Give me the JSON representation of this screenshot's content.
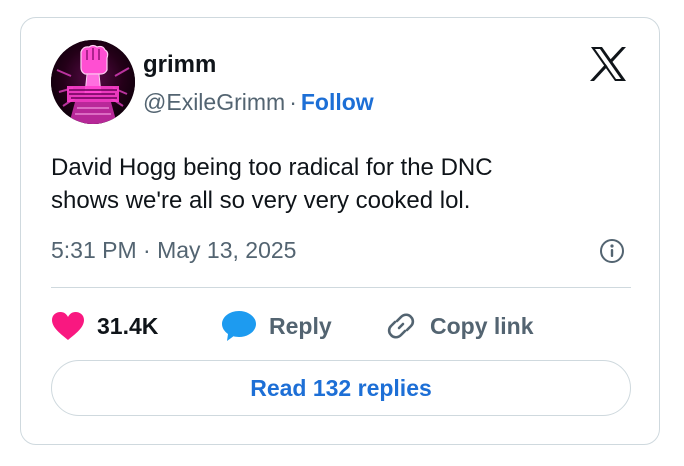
{
  "author": {
    "display_name": "grimm",
    "handle": "@ExileGrimm",
    "separator": "·",
    "follow_label": "Follow",
    "avatar_icon": "pink-raised-fist-avatar"
  },
  "brand": {
    "icon": "x-logo-icon"
  },
  "tweet": {
    "text_line1": "David Hogg being too radical for the DNC",
    "text_line2": "shows we're all so very very cooked lol.",
    "timestamp": "5:31 PM · May 13, 2025"
  },
  "actions": {
    "likes_count": "31.4K",
    "reply_label": "Reply",
    "copy_link_label": "Copy link"
  },
  "read_replies_label": "Read 132 replies",
  "colors": {
    "text_primary": "#0f1419",
    "text_secondary": "#536471",
    "link_blue": "#1d6fd6",
    "like_pink": "#f91880",
    "reply_blue": "#1d9bf0",
    "border": "#cfd9de"
  }
}
